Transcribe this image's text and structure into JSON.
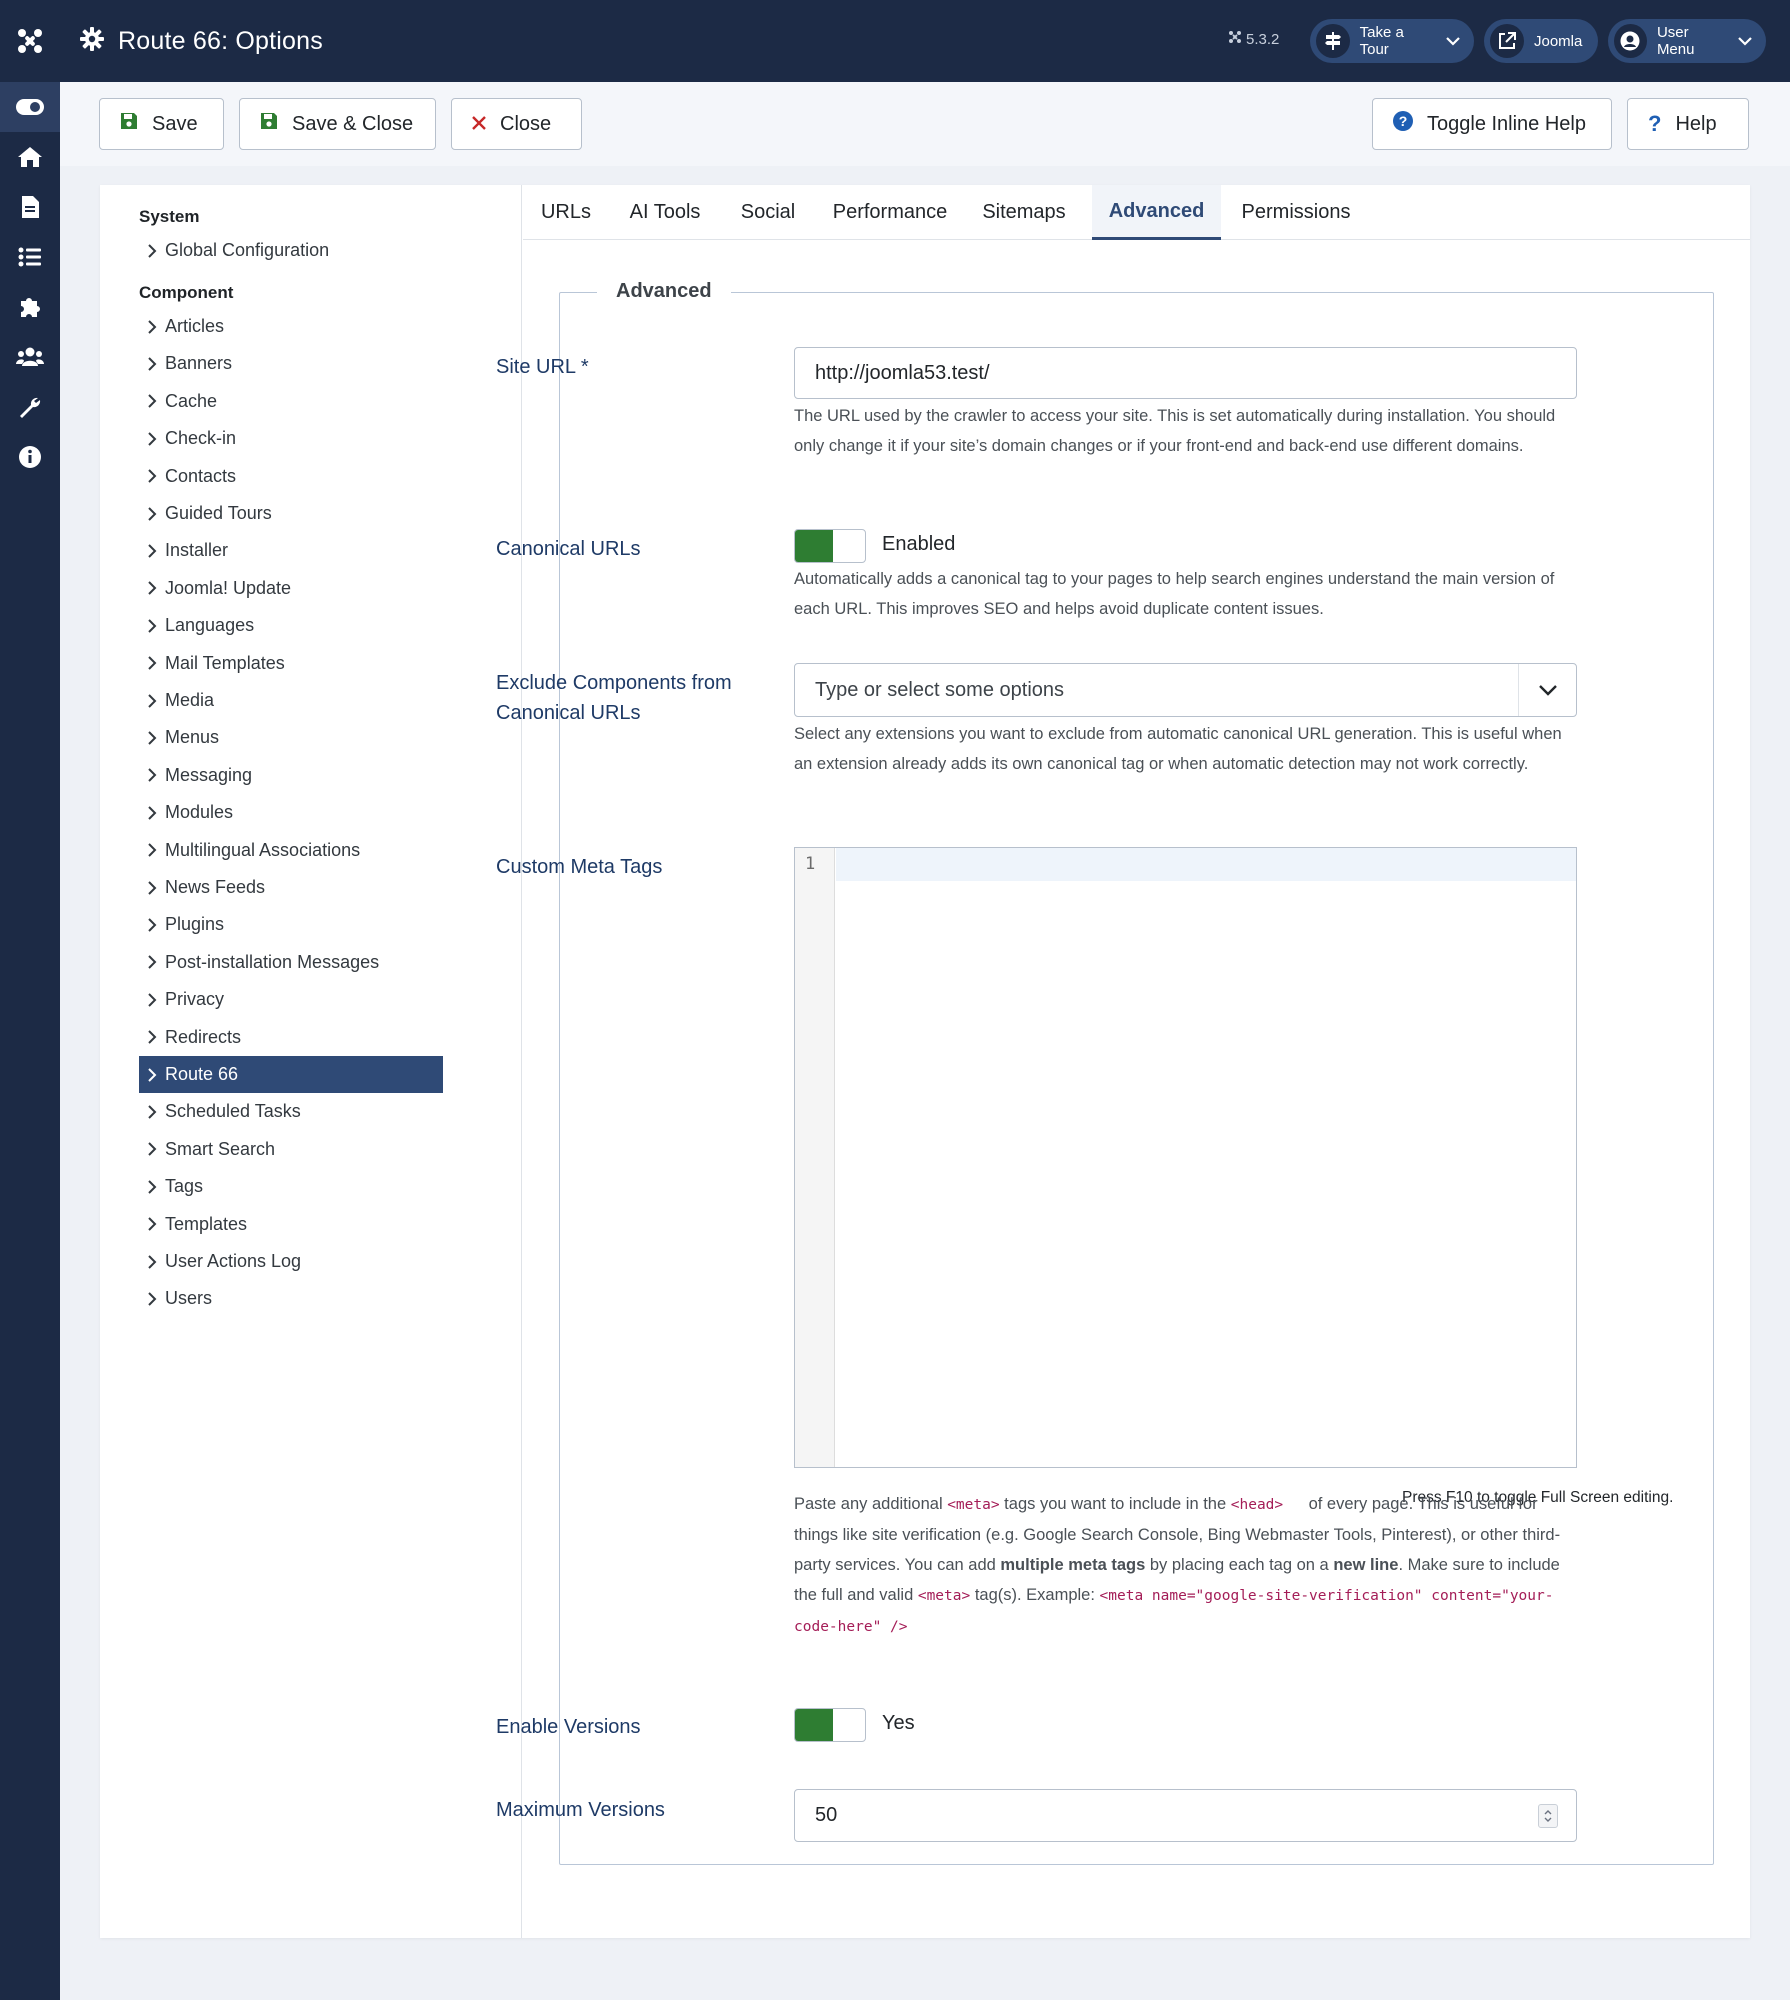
{
  "header": {
    "title": "Route 66: Options",
    "version": "5.3.2",
    "take_tour": "Take a Tour",
    "site_link": "Joomla",
    "user_menu": "User Menu"
  },
  "toolbar": {
    "save": "Save",
    "save_close": "Save & Close",
    "close": "Close",
    "toggle_help": "Toggle Inline Help",
    "help": "Help"
  },
  "sidebar": {
    "system_heading": "System",
    "system_items": [
      "Global Configuration"
    ],
    "component_heading": "Component",
    "items": [
      "Articles",
      "Banners",
      "Cache",
      "Check-in",
      "Contacts",
      "Guided Tours",
      "Installer",
      "Joomla! Update",
      "Languages",
      "Mail Templates",
      "Media",
      "Menus",
      "Messaging",
      "Modules",
      "Multilingual Associations",
      "News Feeds",
      "Plugins",
      "Post-installation Messages",
      "Privacy",
      "Redirects",
      "Route 66",
      "Scheduled Tasks",
      "Smart Search",
      "Tags",
      "Templates",
      "User Actions Log",
      "Users"
    ],
    "active": "Route 66"
  },
  "tabs": [
    "URLs",
    "AI Tools",
    "Social",
    "Performance",
    "Sitemaps",
    "Advanced",
    "Permissions"
  ],
  "active_tab": "Advanced",
  "fieldset": {
    "legend": "Advanced",
    "site_url": {
      "label": "Site URL *",
      "value": "http://joomla53.test/",
      "help": "The URL used by the crawler to access your site. This is set automatically during installation. You should only change it if your site’s domain changes or if your front-end and back-end use different domains."
    },
    "canonical": {
      "label": "Canonical URLs",
      "state": "Enabled",
      "help": "Automatically adds a canonical tag to your pages to help search engines understand the main version of each URL. This improves SEO and helps avoid duplicate content issues."
    },
    "exclude": {
      "label": "Exclude Components from Canonical URLs",
      "placeholder": "Type or select some options",
      "help": "Select any extensions you want to exclude from automatic canonical URL generation. This is useful when an extension already adds its own canonical tag or when automatic detection may not work correctly."
    },
    "meta": {
      "label": "Custom Meta Tags",
      "line_number": "1",
      "fullscreen_hint": "Press F10 to toggle Full Screen editing.",
      "help_1": "Paste any additional ",
      "help_code_meta": "<meta>",
      "help_2": " tags you want to include in the ",
      "help_code_head": "<head>",
      "help_3": " of every page. This is useful for things like site verification (e.g. Google Search Console, Bing Webmaster Tools, Pinterest), or other third-party services. You can add ",
      "help_bold_1": "multiple meta tags",
      "help_4": " by placing each tag on a ",
      "help_bold_2": "new line",
      "help_5": ". Make sure to include the full and valid ",
      "help_code_meta2": "<meta>",
      "help_6": " tag(s). Example: ",
      "help_code_example": "<meta name=\"google-site-verification\" content=\"your-code-here\" />"
    },
    "versions": {
      "label": "Enable Versions",
      "state": "Yes"
    },
    "max_versions": {
      "label": "Maximum Versions",
      "value": "50"
    }
  },
  "colors": {
    "header_bg": "#1c2a45",
    "accent": "#2f4a76",
    "switch_on": "#2e7d32",
    "label": "#1e3a66",
    "code": "#a41d57"
  }
}
